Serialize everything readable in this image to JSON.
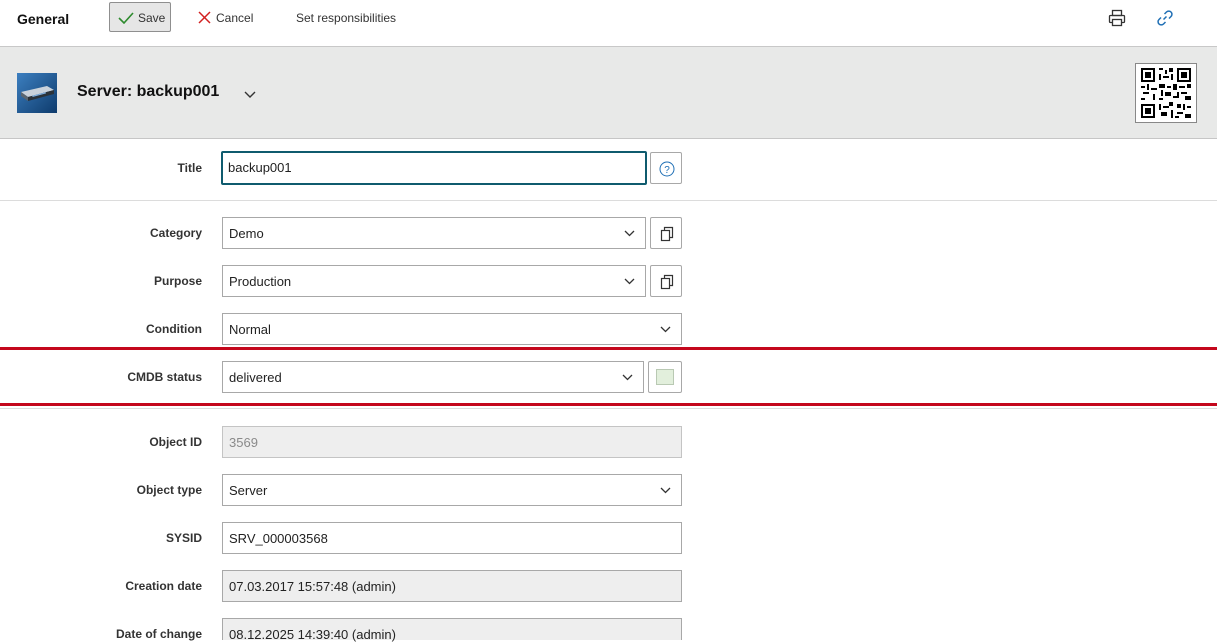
{
  "toolbar": {
    "title": "General",
    "save_label": "Save",
    "cancel_label": "Cancel",
    "responsibilities_label": "Set responsibilities"
  },
  "header": {
    "title": "Server: backup001"
  },
  "form": {
    "title": {
      "label": "Title",
      "value": "backup001"
    },
    "category": {
      "label": "Category",
      "value": "Demo"
    },
    "purpose": {
      "label": "Purpose",
      "value": "Production"
    },
    "condition": {
      "label": "Condition",
      "value": "Normal"
    },
    "cmdb_status": {
      "label": "CMDB status",
      "value": "delivered",
      "color": "#e2efdc"
    },
    "object_id": {
      "label": "Object ID",
      "value": "3569"
    },
    "object_type": {
      "label": "Object type",
      "value": "Server"
    },
    "sysid": {
      "label": "SYSID",
      "value": "SRV_000003568"
    },
    "creation_date": {
      "label": "Creation date",
      "value": "07.03.2017 15:57:48 (admin)"
    },
    "date_of_change": {
      "label": "Date of change",
      "value": "08.12.2025 14:39:40 (admin)"
    }
  },
  "colors": {
    "focus_border": "#0f5b6e",
    "status_highlight": "#c4071c",
    "save_check": "#2e8b2e",
    "cancel_x": "#d22020",
    "link_icon": "#1f6fb5"
  }
}
